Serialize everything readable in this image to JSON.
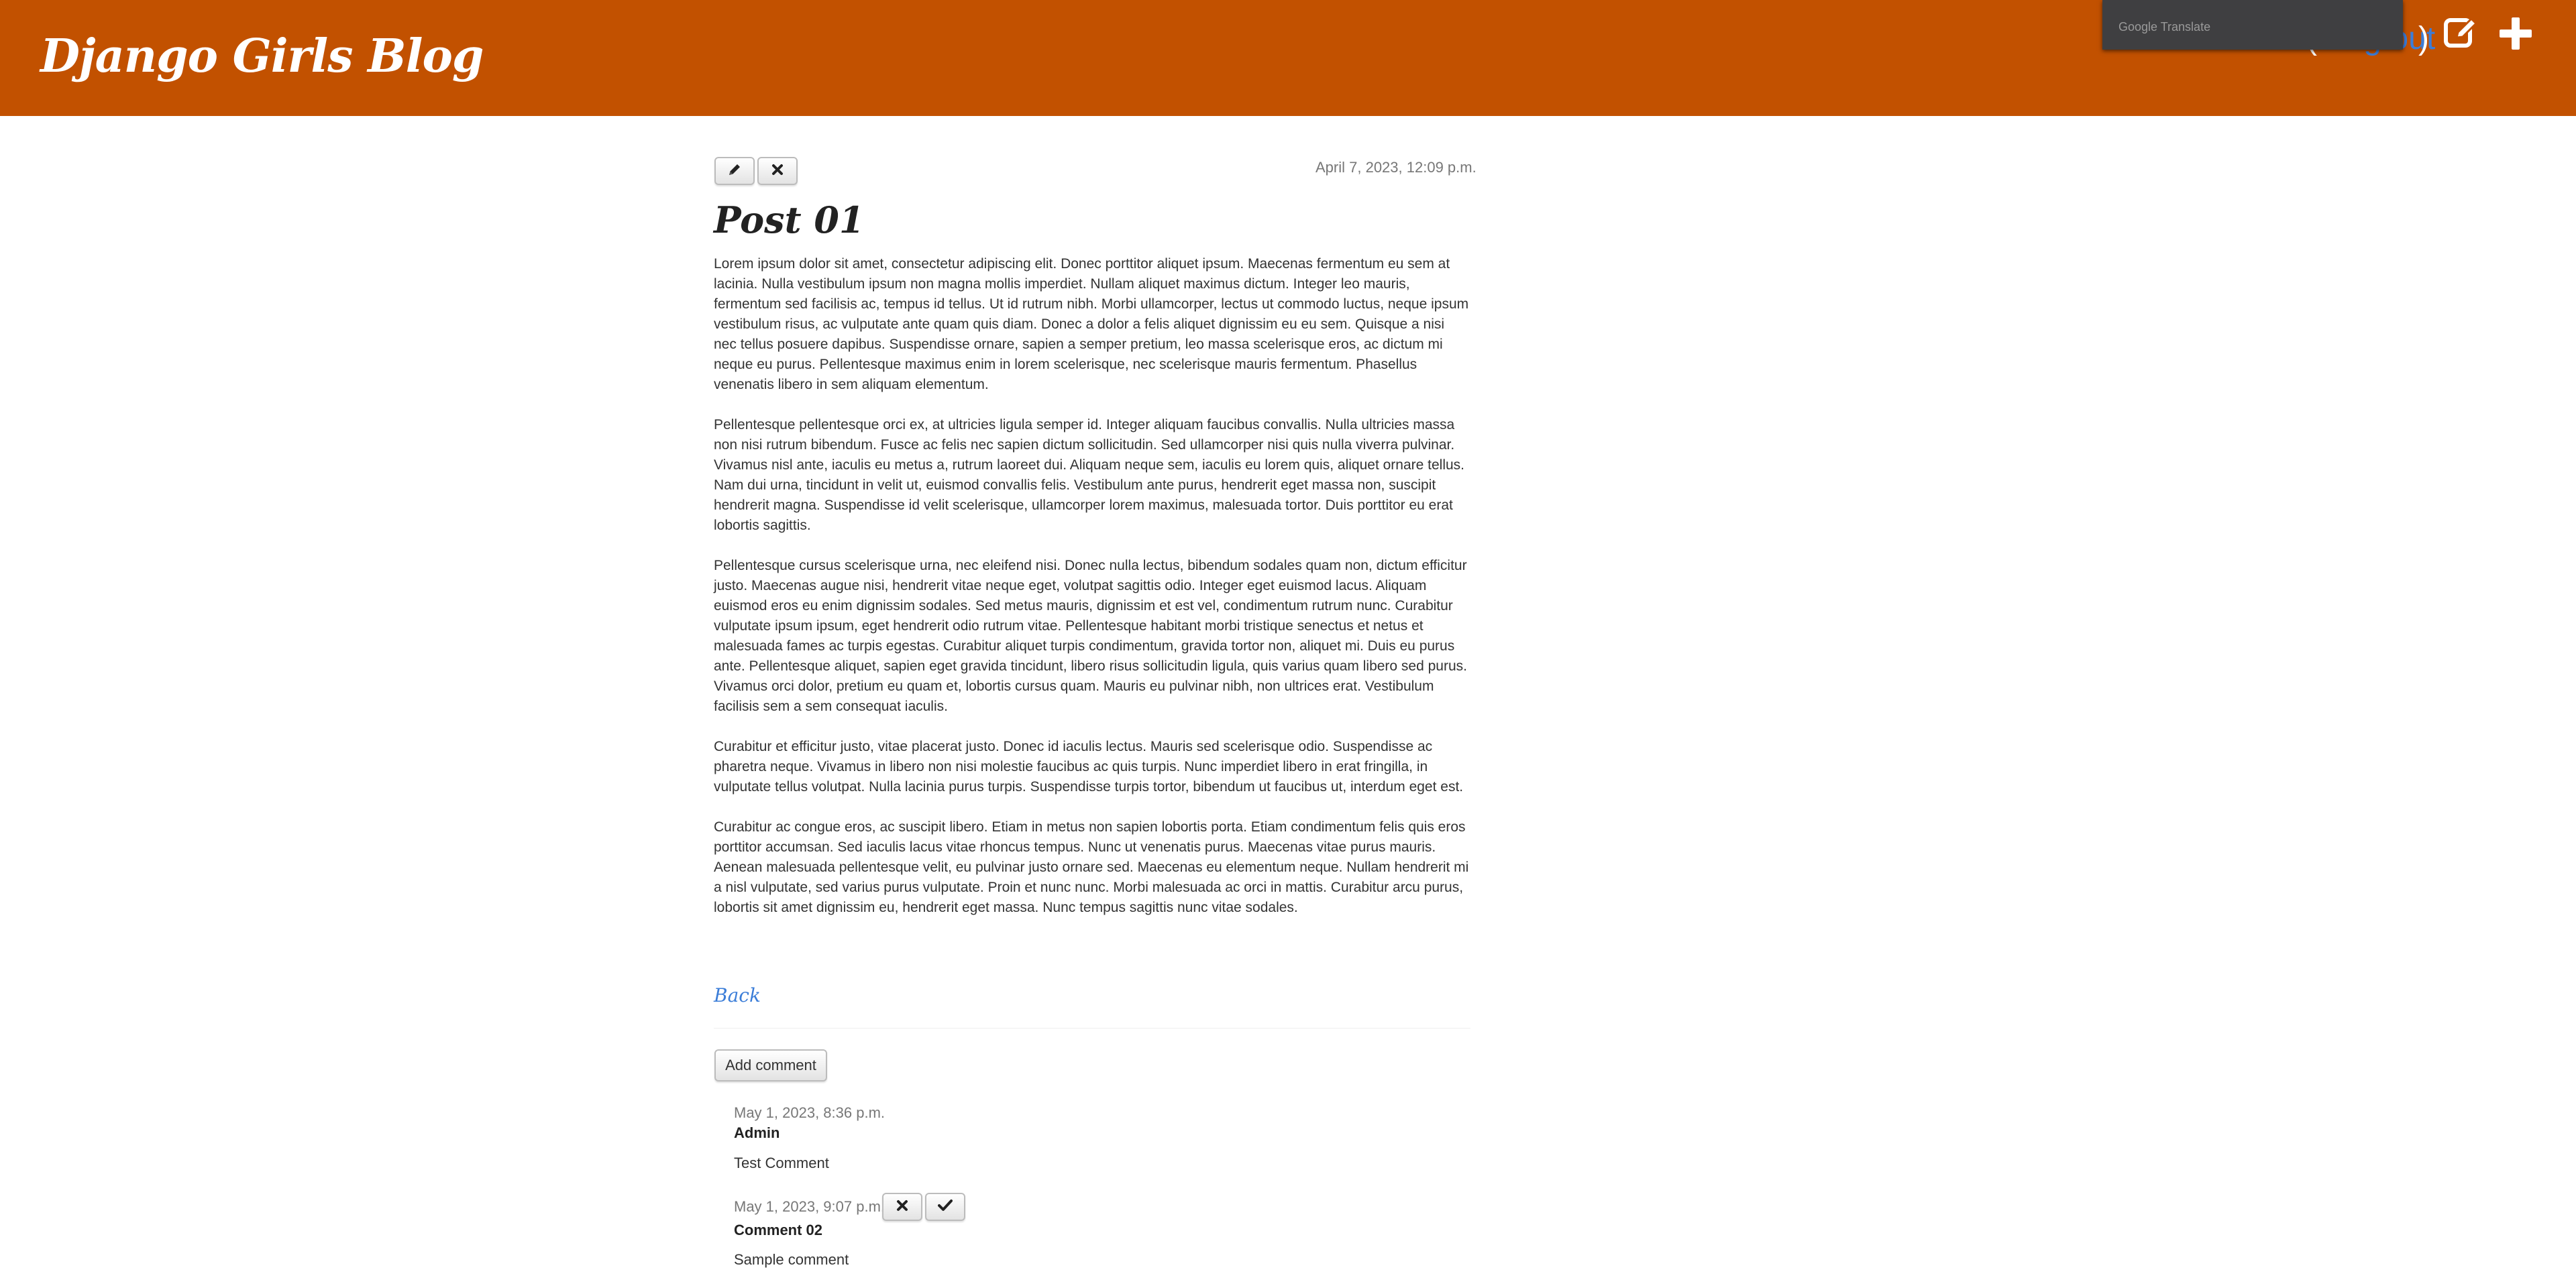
{
  "header": {
    "site_title": "Django Girls Blog",
    "user_link_open": "(",
    "user_link_close": ")",
    "user_link": "Log out",
    "accent": "#c25100"
  },
  "translate_popup": {
    "label": "Google Translate"
  },
  "post": {
    "published_date": "April 7, 2023, 12:09 p.m.",
    "title": "Post 01",
    "paragraphs": [
      "Lorem ipsum dolor sit amet, consectetur adipiscing elit. Donec porttitor aliquet ipsum. Maecenas fermentum eu sem at lacinia. Nulla vestibulum ipsum non magna mollis imperdiet. Nullam aliquet maximus dictum. Integer leo mauris, fermentum sed facilisis ac, tempus id tellus. Ut id rutrum nibh. Morbi ullamcorper, lectus ut commodo luctus, neque ipsum vestibulum risus, ac vulputate ante quam quis diam. Donec a dolor a felis aliquet dignissim eu eu sem. Quisque a nisi nec tellus posuere dapibus. Suspendisse ornare, sapien a semper pretium, leo massa scelerisque eros, ac dictum mi neque eu purus. Pellentesque maximus enim in lorem scelerisque, nec scelerisque mauris fermentum. Phasellus venenatis libero in sem aliquam elementum.",
      "Pellentesque pellentesque orci ex, at ultricies ligula semper id. Integer aliquam faucibus convallis. Nulla ultricies massa non nisi rutrum bibendum. Fusce ac felis nec sapien dictum sollicitudin. Sed ullamcorper nisi quis nulla viverra pulvinar. Vivamus nisl ante, iaculis eu metus a, rutrum laoreet dui. Aliquam neque sem, iaculis eu lorem quis, aliquet ornare tellus. Nam dui urna, tincidunt in velit ut, euismod convallis felis. Vestibulum ante purus, hendrerit eget massa non, suscipit hendrerit magna. Suspendisse id velit scelerisque, ullamcorper lorem maximus, malesuada tortor. Duis porttitor eu erat lobortis sagittis.",
      "Pellentesque cursus scelerisque urna, nec eleifend nisi. Donec nulla lectus, bibendum sodales quam non, dictum efficitur justo. Maecenas augue nisi, hendrerit vitae neque eget, volutpat sagittis odio. Integer eget euismod lacus. Aliquam euismod eros eu enim dignissim sodales. Sed metus mauris, dignissim et est vel, condimentum rutrum nunc. Curabitur vulputate ipsum ipsum, eget hendrerit odio rutrum vitae. Pellentesque habitant morbi tristique senectus et netus et malesuada fames ac turpis egestas. Curabitur aliquet turpis condimentum, gravida tortor non, aliquet mi. Duis eu purus ante. Pellentesque aliquet, sapien eget gravida tincidunt, libero risus sollicitudin ligula, quis varius quam libero sed purus. Vivamus orci dolor, pretium eu quam et, lobortis cursus quam. Mauris eu pulvinar nibh, non ultrices erat. Vestibulum facilisis sem a sem consequat iaculis.",
      "Curabitur et efficitur justo, vitae placerat justo. Donec id iaculis lectus. Mauris sed scelerisque odio. Suspendisse ac pharetra neque. Vivamus in libero non nisi molestie faucibus ac quis turpis. Nunc imperdiet libero in erat fringilla, in vulputate tellus volutpat. Nulla lacinia purus turpis. Suspendisse turpis tortor, bibendum ut faucibus ut, interdum eget est.",
      "Curabitur ac congue eros, ac suscipit libero. Etiam in metus non sapien lobortis porta. Etiam condimentum felis quis eros porttitor accumsan. Sed iaculis lacus vitae rhoncus tempus. Nunc ut venenatis purus. Maecenas vitae purus mauris. Aenean malesuada pellentesque velit, eu pulvinar justo ornare sed. Maecenas eu elementum neque. Nullam hendrerit mi a nisl vulputate, sed varius purus vulputate. Proin et nunc nunc. Morbi malesuada ac orci in mattis. Curabitur arcu purus, lobortis sit amet dignissim eu, hendrerit eget massa. Nunc tempus sagittis nunc vitae sodales."
    ]
  },
  "back_link": "Back",
  "add_comment_label": "Add comment",
  "comments": [
    {
      "date": "May 1, 2023, 8:36 p.m.",
      "author": "Admin",
      "text": "Test Comment"
    },
    {
      "date": "May 1, 2023, 9:07 p.m.",
      "author": "Comment 02",
      "text": "Sample comment"
    }
  ],
  "icons": {
    "edit_post": "pencil-icon",
    "remove_post": "close-icon",
    "header_edit": "edit-square-icon",
    "header_add": "plus-icon",
    "remove_comment": "close-icon",
    "approve_comment": "check-icon"
  }
}
